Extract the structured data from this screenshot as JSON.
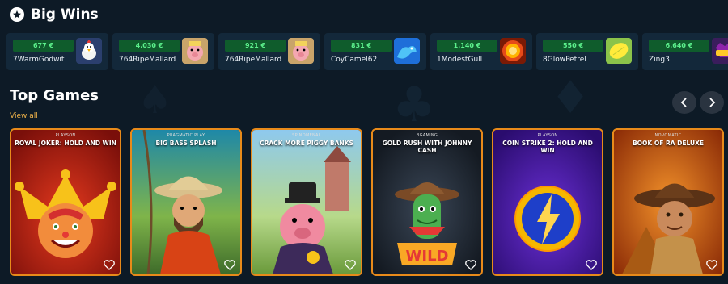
{
  "big_wins": {
    "title": "Big Wins",
    "icon": "star-icon",
    "items": [
      {
        "amount": "677 €",
        "user": "7WarmGodwit",
        "thumb": "chicken-game-icon"
      },
      {
        "amount": "4,030 €",
        "user": "764RipeMallard",
        "thumb": "pig-game-icon"
      },
      {
        "amount": "921 €",
        "user": "764RipeMallard",
        "thumb": "pig-game-icon"
      },
      {
        "amount": "831 €",
        "user": "CoyCamel62",
        "thumb": "dragon-game-icon"
      },
      {
        "amount": "1,140 €",
        "user": "1ModestGull",
        "thumb": "sun-game-icon"
      },
      {
        "amount": "550 €",
        "user": "8GlowPetrel",
        "thumb": "lemon-game-icon"
      },
      {
        "amount": "6,640 €",
        "user": "Zing3",
        "thumb": "wild-game-icon"
      }
    ]
  },
  "top_games": {
    "title": "Top Games",
    "view_all": "View all",
    "prev_icon": "chevron-left-icon",
    "next_icon": "chevron-right-icon",
    "cards": [
      {
        "provider": "PLAYSON",
        "name": "ROYAL JOKER: HOLD AND WIN"
      },
      {
        "provider": "PRAGMATIC PLAY",
        "name": "BIG BASS SPLASH"
      },
      {
        "provider": "SPINOMENAL",
        "name": "CRACK MORE PIGGY BANKS"
      },
      {
        "provider": "BGAMING",
        "name": "GOLD RUSH WITH JOHNNY CASH"
      },
      {
        "provider": "PLAYSON",
        "name": "COIN STRIKE 2: HOLD AND WIN"
      },
      {
        "provider": "NOVOMATIC",
        "name": "BOOK OF RA DELUXE"
      }
    ],
    "card_icon": "heart-icon"
  },
  "colors": {
    "background": "#0d1a26",
    "card_border": "#e88a1a",
    "win_amount_bg": "#0f5c2c",
    "win_amount_text": "#5cf08c",
    "view_all": "#f0b34a"
  }
}
